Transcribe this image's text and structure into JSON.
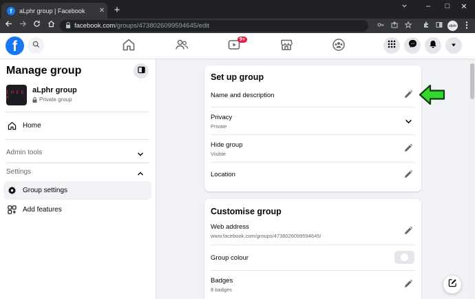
{
  "browser": {
    "tab_title": "aLphr group | Facebook",
    "tab_favicon": "f",
    "close_glyph": "✕",
    "new_tab_glyph": "+",
    "url_domain": "facebook.com",
    "url_path": "/groups/4738026099594645/edit",
    "profile_label": "alphr",
    "controls": {
      "minimize": "–",
      "maximize": "□",
      "close": "✕"
    }
  },
  "topnav": {
    "logo_letter": "f",
    "video_badge": "9+",
    "brand_color": "#1877f2"
  },
  "sidebar": {
    "title": "Manage group",
    "group": {
      "name": "aLphr group",
      "privacy": "Private group",
      "thumb_text": "I M E D V"
    },
    "home_label": "Home",
    "admin_tools_label": "Admin tools",
    "settings_label": "Settings",
    "group_settings_label": "Group settings",
    "add_features_label": "Add features"
  },
  "setup_card": {
    "title": "Set up group",
    "rows": [
      {
        "label": "Name and description",
        "sub": ""
      },
      {
        "label": "Privacy",
        "sub": "Private"
      },
      {
        "label": "Hide group",
        "sub": "Visible"
      },
      {
        "label": "Location",
        "sub": ""
      }
    ]
  },
  "customise_card": {
    "title": "Customise group",
    "rows": [
      {
        "label": "Web address",
        "sub": "www.facebook.com/groups/4738026099594645/"
      },
      {
        "label": "Group colour",
        "sub": ""
      },
      {
        "label": "Badges",
        "sub": "8 badges"
      }
    ]
  },
  "icons": {
    "edit": "pencil-icon",
    "dropdown": "chevron-down-icon",
    "annotation": "green-arrow-icon",
    "annotation_color": "#35d72f"
  }
}
